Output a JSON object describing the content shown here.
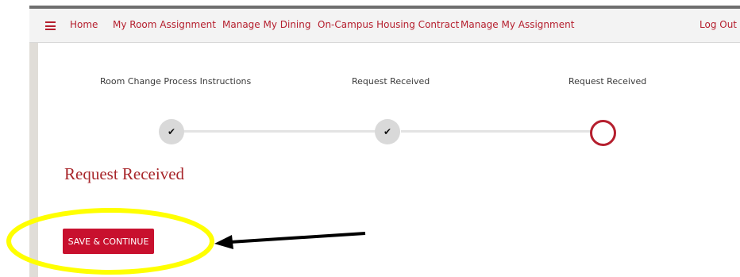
{
  "nav": {
    "home": "Home",
    "room_assignment": "My Room Assignment",
    "dining": "Manage My Dining",
    "housing_contract": "On-Campus Housing Contract",
    "manage_assignment": "Manage My Assignment",
    "logout": "Log Out"
  },
  "steps": [
    {
      "label": "Room Change Process Instructions",
      "status": "complete",
      "icon": "checkmark-icon",
      "glyph": "✔"
    },
    {
      "label": "Request Received",
      "status": "complete",
      "icon": "checkmark-icon",
      "glyph": "✔"
    },
    {
      "label": "Request Received",
      "status": "current",
      "icon": "current-step-circle"
    }
  ],
  "page_title": "Request Received",
  "save_button_label": "SAVE & CONTINUE",
  "colors": {
    "accent": "#b51f2e",
    "button": "#c8102e",
    "highlight": "#ffff00",
    "arrow": "#000000"
  },
  "annotation": {
    "type": "yellow-ellipse-and-arrow",
    "target": "save-button"
  }
}
